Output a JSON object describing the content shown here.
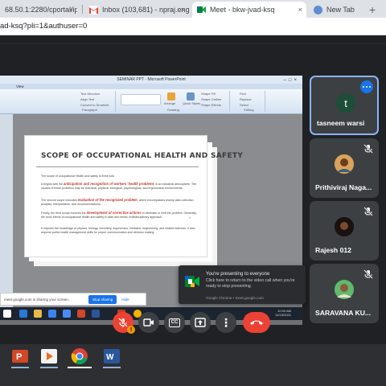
{
  "browser": {
    "tabs": [
      {
        "title": "68.50.1:2280/cportal/ip/l",
        "active": false
      },
      {
        "title": "Inbox (103,681) - npraj.engg@",
        "active": false
      },
      {
        "title": "Meet - bkw-jvad-ksq",
        "active": true
      },
      {
        "title": "New Tab",
        "active": false
      }
    ],
    "close_glyph": "×",
    "newtab_glyph": "+",
    "url": "ad-ksq?pli=1&authuser=0"
  },
  "presentation": {
    "window_title": "SEMINAR PPT - Microsoft PowerPoint",
    "menu": "View",
    "ribbon": {
      "items_left": [
        "Text Direction",
        "Align Text",
        "Convert to SmartArt"
      ],
      "paragraph_caption": "Paragraph",
      "drawing_caption": "Drawing",
      "editing_caption": "Editing",
      "arrange_label": "Arrange",
      "quick_styles_label": "Quick Styles",
      "shape_items": [
        "Shape Fill",
        "Shape Outline",
        "Shape Effects"
      ],
      "edit_items": [
        "Find",
        "Replace",
        "Select"
      ]
    },
    "slide": {
      "title": "SCOPE OF OCCUPATIONAL HEALTH AND SAFETY",
      "para1": "The scope of occupational Health and safety is three-fold.",
      "para2_pre": "It begins with the ",
      "para2_hl": "anticipation and recognition of workers' health problems",
      "para2_post": " in an industrial atmosphere. The causes of these problems may be chemical, physical, biological, psychological, and ergonomical environments.",
      "para3_pre": "The second scope indicates ",
      "para3_hl": "evaluation of the recognized problem",
      "para3_post": ", which encompasses mainly data collection, analysis, interpretation, and recommendations.",
      "para4_pre": "Finally, the third scope involves the ",
      "para4_hl": "development of corrective actions",
      "para4_post": " to eliminate or limit the problem. Generally, the work theme of occupational health and safety is wide and needs multidisciplinary approach.",
      "para5": "It requires the knowledge of physics, biology, chemistry, ergonomics, medicine, engineering, and related sciences. It also requires public health management skills for proper communication and decision making.",
      "page": "3"
    },
    "sharebar": {
      "text": "meet.google.com is sharing your screen.",
      "stop_label": "Stop sharing",
      "hide_label": "Hide"
    },
    "clock": {
      "time": "10:00 AM",
      "date": "11/15/2021"
    }
  },
  "toast": {
    "title": "You're presenting to everyone",
    "body": "Click here to return to the video call when you're ready to stop presenting.",
    "source": "Google Chrome • meet.google.com"
  },
  "participants": [
    {
      "name": "tasneem warsi",
      "avatar": "t",
      "avatar_color": "#1e4d3a",
      "muted": false,
      "speaking": true
    },
    {
      "name": "Prithiviraj Naga...",
      "avatar_color": "#c78a2f",
      "muted": true
    },
    {
      "name": "Rajesh 012",
      "avatar_color": "#2a1c16",
      "muted": true
    },
    {
      "name": "SARAVANA KU...",
      "avatar_color": "#3f9d4a",
      "muted": true
    }
  ],
  "controls": {
    "mic_state": "muted",
    "alert_glyph": "!",
    "cc_label": "CC",
    "more_label": "⋮",
    "colors": {
      "red": "#ea4335",
      "dark": "#3c4043",
      "accent": "#1a73e8"
    }
  },
  "taskbar_icons": [
    "powerpoint-icon",
    "media-player-icon",
    "chrome-icon",
    "word-icon"
  ]
}
